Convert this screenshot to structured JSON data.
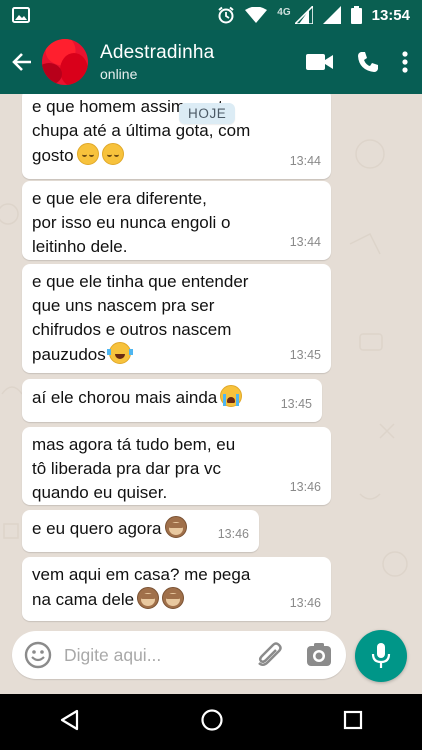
{
  "status_bar": {
    "time": "13:54",
    "network_label": "4G",
    "icons": [
      "image-icon",
      "alarm-icon",
      "wifi-icon",
      "signal-icon",
      "signal-icon",
      "battery-icon"
    ]
  },
  "header": {
    "contact_name": "Adestradinha",
    "contact_status": "online",
    "icons": [
      "back-arrow-icon",
      "video-call-icon",
      "phone-icon",
      "more-vert-icon"
    ]
  },
  "date_chip": "HOJE",
  "messages": [
    {
      "text": "e que homem assim gente\nchupa até a última gota, com\ngosto",
      "emoji": [
        "relieved",
        "relieved"
      ],
      "time": "13:44"
    },
    {
      "text": "e que ele era diferente,\npor isso eu nunca engoli o\nleitinho dele.",
      "emoji": [],
      "time": "13:44"
    },
    {
      "text": "e que ele tinha que entender\nque uns nascem pra ser\nchifrudos e outros nascem\npauzudos",
      "emoji": [
        "joy"
      ],
      "time": "13:45"
    },
    {
      "text": "aí ele chorou mais ainda",
      "emoji": [
        "sob"
      ],
      "time": "13:45"
    },
    {
      "text": "mas agora tá tudo bem, eu\ntô liberada pra dar pra vc\nquando eu quiser.",
      "emoji": [],
      "time": "13:46"
    },
    {
      "text": "e eu quero agora",
      "emoji": [
        "monkey"
      ],
      "time": "13:46"
    },
    {
      "text": "vem aqui em casa? me pega\nna cama dele",
      "emoji": [
        "monkey",
        "monkey"
      ],
      "time": "13:46"
    }
  ],
  "input": {
    "placeholder": "Digite aqui...",
    "icons": [
      "emoji-icon",
      "attach-icon",
      "camera-icon",
      "mic-icon"
    ]
  },
  "navigation": {
    "icons": [
      "back-triangle-icon",
      "home-circle-icon",
      "recents-square-icon"
    ]
  },
  "colors": {
    "header": "#075e54",
    "status_bar": "#0a5f51",
    "mic_button": "#009688",
    "chat_background": "#e5ddd5",
    "date_chip": "#dcecf5"
  }
}
